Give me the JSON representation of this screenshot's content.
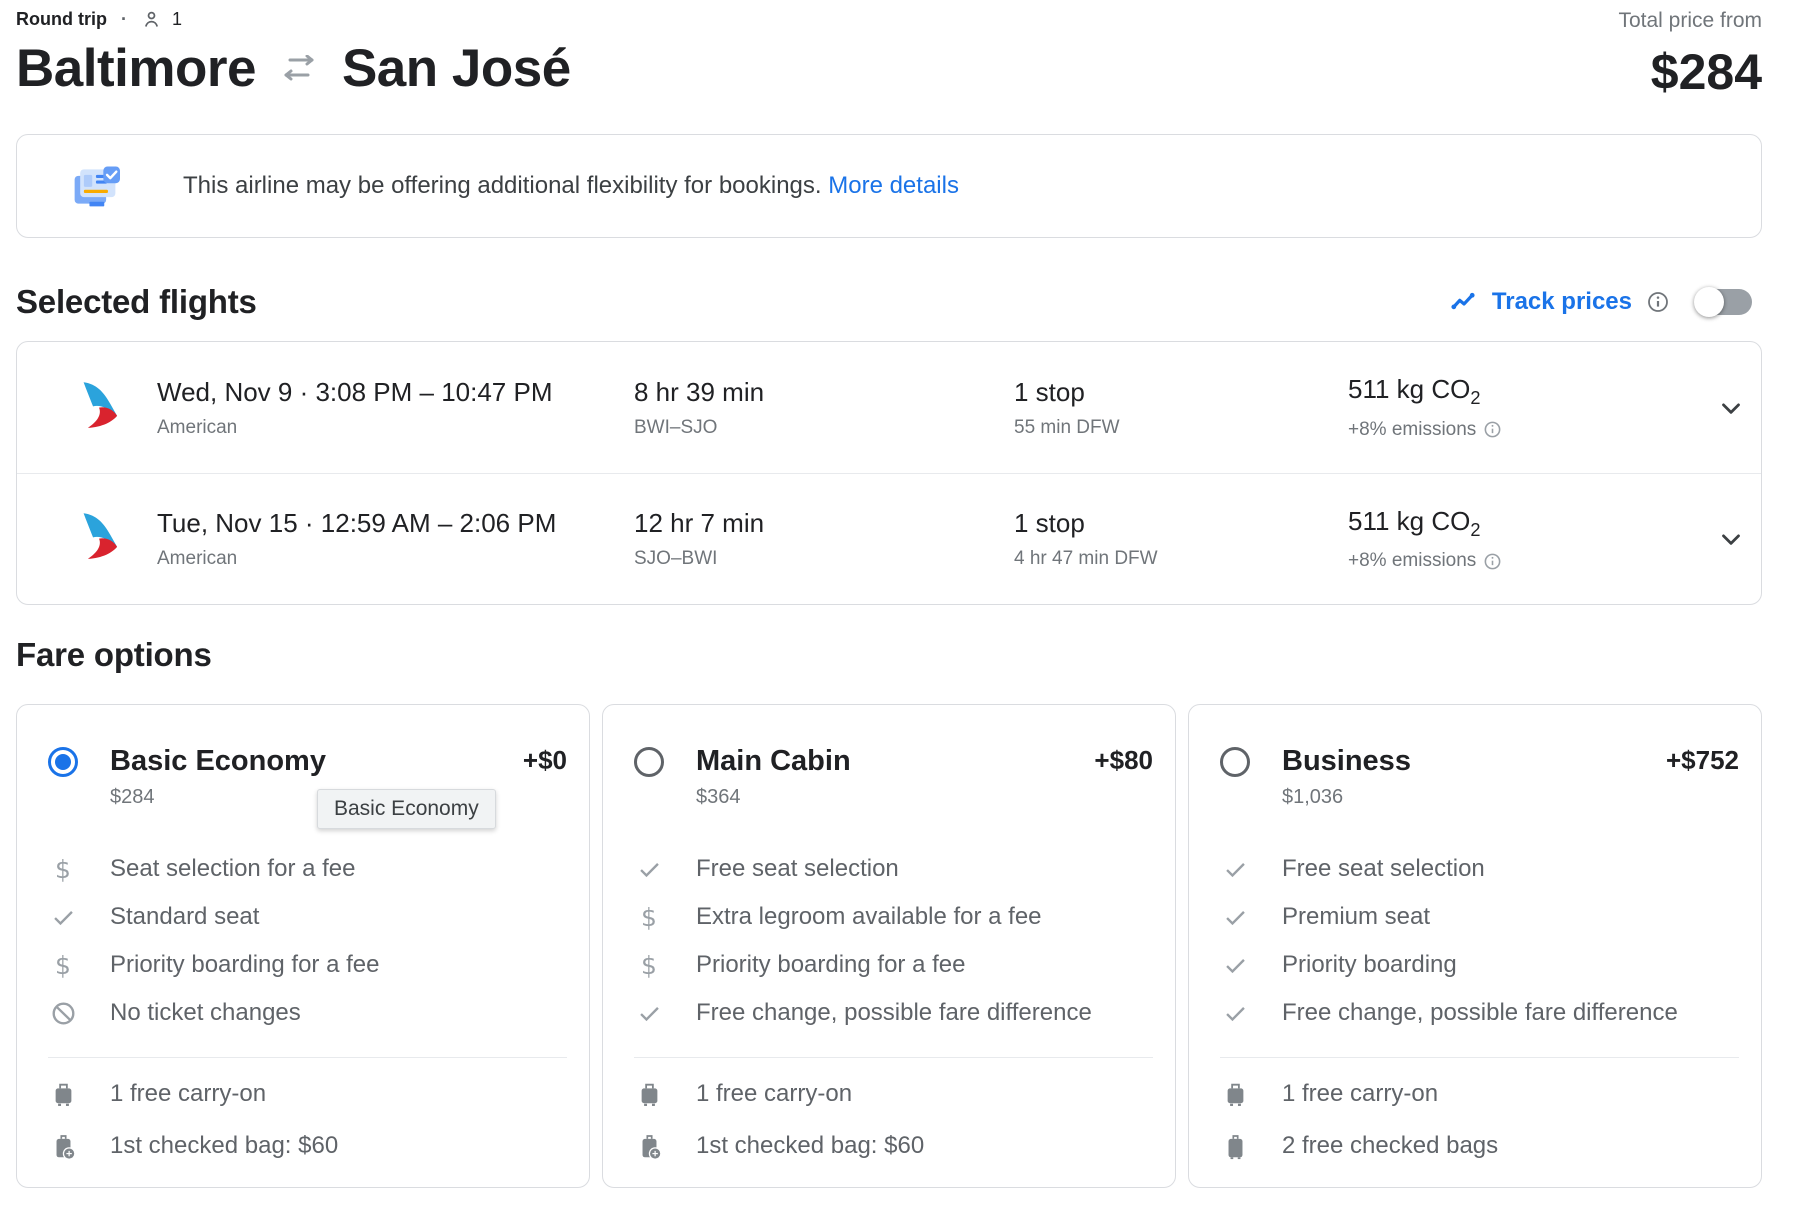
{
  "header": {
    "trip_type": "Round trip",
    "separator": "·",
    "passengers": "1",
    "origin": "Baltimore",
    "destination": "San José",
    "total_price_label": "Total price from",
    "total_price": "$284"
  },
  "banner": {
    "text": "This airline may be offering additional flexibility for bookings.",
    "link_label": "More details"
  },
  "selected_flights": {
    "title": "Selected flights",
    "track_prices_label": "Track prices",
    "toggle_state": "off",
    "flights": [
      {
        "airline": "American",
        "date_time": "Wed, Nov 9 · 3:08 PM – 10:47 PM",
        "duration": "8 hr 39 min",
        "route": "BWI–SJO",
        "stops": "1 stop",
        "stop_detail": "55 min DFW",
        "co2": "511 kg CO",
        "co2_subscript": "2",
        "emissions": "+8% emissions"
      },
      {
        "airline": "American",
        "date_time": "Tue, Nov 15 · 12:59 AM – 2:06 PM",
        "duration": "12 hr 7 min",
        "route": "SJO–BWI",
        "stops": "1 stop",
        "stop_detail": "4 hr 47 min DFW",
        "co2": "511 kg CO",
        "co2_subscript": "2",
        "emissions": "+8% emissions"
      }
    ]
  },
  "fare_options": {
    "title": "Fare options",
    "tooltip": "Basic Economy",
    "cards": [
      {
        "name": "Basic Economy",
        "price": "$284",
        "delta": "+$0",
        "selected": true,
        "features": [
          {
            "icon": "dollar-icon",
            "text": "Seat selection for a fee"
          },
          {
            "icon": "check-icon",
            "text": "Standard seat"
          },
          {
            "icon": "dollar-icon",
            "text": "Priority boarding for a fee"
          },
          {
            "icon": "no-changes-icon",
            "text": "No ticket changes"
          }
        ],
        "baggage": [
          {
            "icon": "carry-on-bag-icon",
            "text": "1 free carry-on"
          },
          {
            "icon": "checked-bag-fee-icon",
            "text": "1st checked bag: $60"
          }
        ]
      },
      {
        "name": "Main Cabin",
        "price": "$364",
        "delta": "+$80",
        "selected": false,
        "features": [
          {
            "icon": "check-icon",
            "text": "Free seat selection"
          },
          {
            "icon": "dollar-icon",
            "text": "Extra legroom available for a fee"
          },
          {
            "icon": "dollar-icon",
            "text": "Priority boarding for a fee"
          },
          {
            "icon": "check-icon",
            "text": "Free change, possible fare difference"
          }
        ],
        "baggage": [
          {
            "icon": "carry-on-bag-icon",
            "text": "1 free carry-on"
          },
          {
            "icon": "checked-bag-fee-icon",
            "text": "1st checked bag: $60"
          }
        ]
      },
      {
        "name": "Business",
        "price": "$1,036",
        "delta": "+$752",
        "selected": false,
        "features": [
          {
            "icon": "check-icon",
            "text": "Free seat selection"
          },
          {
            "icon": "check-icon",
            "text": "Premium seat"
          },
          {
            "icon": "check-icon",
            "text": "Priority boarding"
          },
          {
            "icon": "check-icon",
            "text": "Free change, possible fare difference"
          }
        ],
        "baggage": [
          {
            "icon": "carry-on-bag-icon",
            "text": "1 free carry-on"
          },
          {
            "icon": "checked-bag-icon",
            "text": "2 free checked bags"
          }
        ]
      }
    ]
  },
  "colors": {
    "accent_blue": "#1a73e8",
    "text_dark": "#202124",
    "text_gray": "#70757a",
    "border": "#dadce0",
    "aa_logo_blue": "#2ba3dc",
    "aa_logo_red": "#d9232e"
  }
}
